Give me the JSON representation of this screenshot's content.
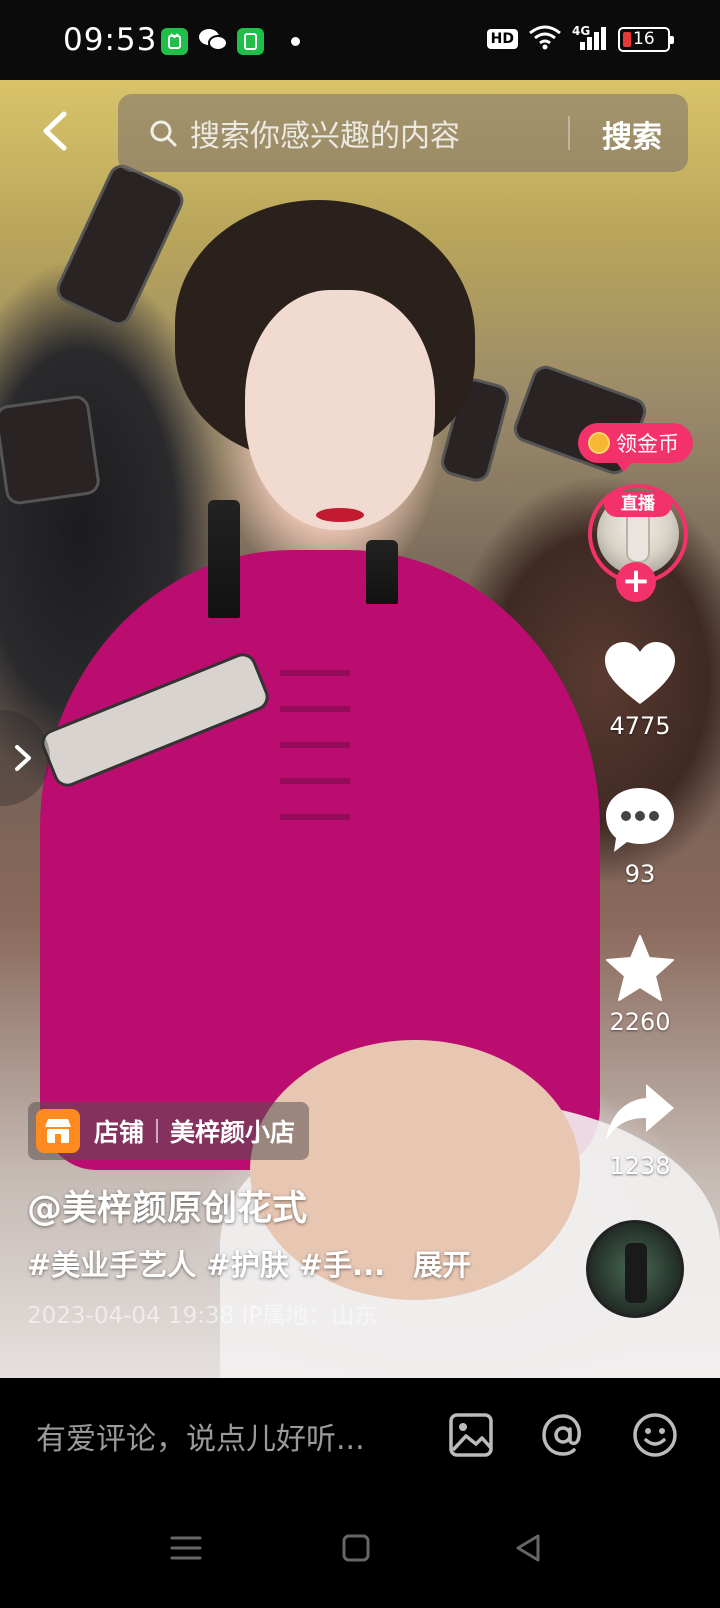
{
  "status_bar": {
    "time": "09:53",
    "hd": "HD",
    "network": "4G",
    "battery": "16",
    "icons": [
      "app-notification-icon",
      "wechat-icon",
      "app-notification-icon",
      "dot-icon",
      "wifi-icon",
      "signal-icon",
      "battery-icon"
    ]
  },
  "search": {
    "placeholder": "搜索你感兴趣的内容",
    "button_label": "搜索"
  },
  "right_rail": {
    "coin_label": "领金币",
    "live_label": "直播",
    "follow_symbol": "+",
    "likes": "4775",
    "comments": "93",
    "favorites": "2260",
    "shares": "1238"
  },
  "shop": {
    "label": "店铺",
    "name": "美梓颜小店"
  },
  "post": {
    "author": "@美梓颜原创花式",
    "description": "#美业手艺人 #护肤 #手...",
    "expand": "展开",
    "meta": "2023-04-04 19:38  IP属地：山东"
  },
  "comment": {
    "placeholder": "有爱评论，说点儿好听..."
  },
  "colors": {
    "accent": "#f3326b",
    "shop_icon": "#ff8a1f"
  }
}
